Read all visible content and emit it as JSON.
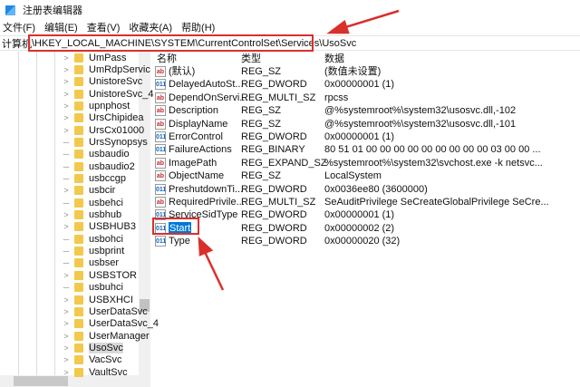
{
  "window": {
    "title": "注册表编辑器"
  },
  "menu": [
    "文件(F)",
    "编辑(E)",
    "查看(V)",
    "收藏夹(A)",
    "帮助(H)"
  ],
  "address": {
    "label": "计算机",
    "path": "\\HKEY_LOCAL_MACHINE\\SYSTEM\\CurrentControlSet\\Services\\UsoSvc"
  },
  "tree": [
    {
      "label": "UmPass",
      "expandable": true
    },
    {
      "label": "UmRdpServic",
      "expandable": true
    },
    {
      "label": "UnistoreSvc",
      "expandable": true
    },
    {
      "label": "UnistoreSvc_4",
      "expandable": true
    },
    {
      "label": "upnphost",
      "expandable": true
    },
    {
      "label": "UrsChipidea",
      "expandable": true
    },
    {
      "label": "UrsCx01000",
      "expandable": true
    },
    {
      "label": "UrsSynopsys",
      "expandable": false
    },
    {
      "label": "usbaudio",
      "expandable": false
    },
    {
      "label": "usbaudio2",
      "expandable": false
    },
    {
      "label": "usbccgp",
      "expandable": false
    },
    {
      "label": "usbcir",
      "expandable": true
    },
    {
      "label": "usbehci",
      "expandable": false
    },
    {
      "label": "usbhub",
      "expandable": true
    },
    {
      "label": "USBHUB3",
      "expandable": true
    },
    {
      "label": "usbohci",
      "expandable": false
    },
    {
      "label": "usbprint",
      "expandable": false
    },
    {
      "label": "usbser",
      "expandable": false
    },
    {
      "label": "USBSTOR",
      "expandable": true
    },
    {
      "label": "usbuhci",
      "expandable": false
    },
    {
      "label": "USBXHCI",
      "expandable": true
    },
    {
      "label": "UserDataSvc",
      "expandable": true
    },
    {
      "label": "UserDataSvc_4",
      "expandable": true
    },
    {
      "label": "UserManager",
      "expandable": true
    },
    {
      "label": "UsoSvc",
      "expandable": true,
      "selected": true
    },
    {
      "label": "VacSvc",
      "expandable": true
    },
    {
      "label": "VaultSvc",
      "expandable": true
    }
  ],
  "columns": {
    "name": "名称",
    "type": "类型",
    "data": "数据"
  },
  "values": [
    {
      "icon": "string-value-icon",
      "name": "(默认)",
      "type": "REG_SZ",
      "data": "(数值未设置)"
    },
    {
      "icon": "binary-value-icon",
      "name": "DelayedAutoSt...",
      "type": "REG_DWORD",
      "data": "0x00000001 (1)"
    },
    {
      "icon": "string-value-icon",
      "name": "DependOnServi...",
      "type": "REG_MULTI_SZ",
      "data": "rpcss"
    },
    {
      "icon": "string-value-icon",
      "name": "Description",
      "type": "REG_SZ",
      "data": "@%systemroot%\\system32\\usosvc.dll,-102"
    },
    {
      "icon": "string-value-icon",
      "name": "DisplayName",
      "type": "REG_SZ",
      "data": "@%systemroot%\\system32\\usosvc.dll,-101"
    },
    {
      "icon": "binary-value-icon",
      "name": "ErrorControl",
      "type": "REG_DWORD",
      "data": "0x00000001 (1)"
    },
    {
      "icon": "binary-value-icon",
      "name": "FailureActions",
      "type": "REG_BINARY",
      "data": "80 51 01 00 00 00 00 00 00 00 00 00 03 00 00 ..."
    },
    {
      "icon": "string-value-icon",
      "name": "ImagePath",
      "type": "REG_EXPAND_SZ",
      "data": "%systemroot%\\system32\\svchost.exe -k netsvc..."
    },
    {
      "icon": "string-value-icon",
      "name": "ObjectName",
      "type": "REG_SZ",
      "data": "LocalSystem"
    },
    {
      "icon": "binary-value-icon",
      "name": "PreshutdownTi...",
      "type": "REG_DWORD",
      "data": "0x0036ee80 (3600000)"
    },
    {
      "icon": "string-value-icon",
      "name": "RequiredPrivile...",
      "type": "REG_MULTI_SZ",
      "data": "SeAuditPrivilege SeCreateGlobalPrivilege SeCre..."
    },
    {
      "icon": "binary-value-icon",
      "name": "ServiceSidType",
      "type": "REG_DWORD",
      "data": "0x00000001 (1)"
    },
    {
      "icon": "binary-value-icon",
      "name": "Start",
      "type": "REG_DWORD",
      "data": "0x00000002 (2)",
      "selected": true
    },
    {
      "icon": "binary-value-icon",
      "name": "Type",
      "type": "REG_DWORD",
      "data": "0x00000020 (32)"
    }
  ],
  "colors": {
    "annotation": "#d9302c",
    "selection": "#0078d7"
  }
}
